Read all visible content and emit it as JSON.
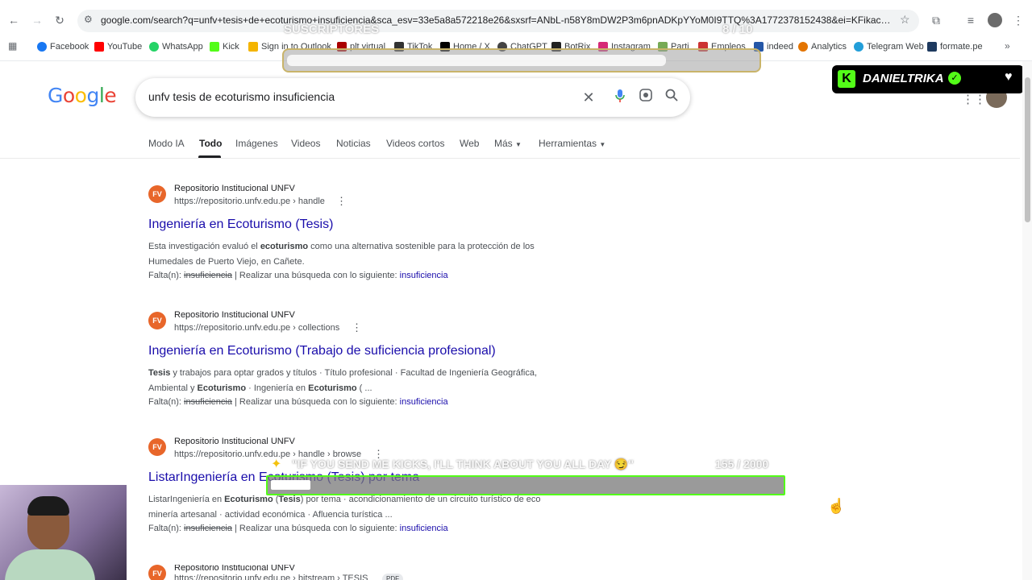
{
  "browser": {
    "url": "google.com/search?q=unfv+tesis+de+ecoturismo+insuficiencia&sca_esv=33e5a8a572218e26&sxsrf=ANbL-n58Y8mDW2P3m6pnADKpYYoM0I9TTQ%3A1772378152438&ei=KFikacW0GqjR1sQPh9r...",
    "bookmarks": [
      "Facebook",
      "YouTube",
      "WhatsApp",
      "Kick",
      "Sign in to Outlook",
      "plt virtual",
      "TikTok",
      "Home / X",
      "ChatGPT",
      "BotRix",
      "Instagram",
      "Parti",
      "Empleos",
      "indeed",
      "Analytics",
      "Telegram Web",
      "formate.pe"
    ]
  },
  "google": {
    "query": "unfv tesis de ecoturismo insuficiencia",
    "tabs": [
      "Modo IA",
      "Todo",
      "Imágenes",
      "Videos",
      "Noticias",
      "Videos cortos",
      "Web",
      "Más",
      "Herramientas"
    ],
    "active_tab": "Todo"
  },
  "results": [
    {
      "favicon": "FV",
      "site": "Repositorio Institucional UNFV",
      "cite": "https://repositorio.unfv.edu.pe › handle",
      "title": "Ingeniería en Ecoturismo (Tesis)",
      "snippet_1a": "Esta investigación evaluó el ",
      "snippet_1b": "ecoturismo",
      "snippet_1c": " como una alternativa sostenible para la protección de los",
      "snippet_2": "Humedales de Puerto Viejo, en Cañete.",
      "missing_label": "Falta(n): ",
      "missing_word": "insuficiencia",
      "missing_action": " | Realizar una búsqueda con lo siguiente: ",
      "missing_link": "insuficiencia"
    },
    {
      "favicon": "FV",
      "site": "Repositorio Institucional UNFV",
      "cite": "https://repositorio.unfv.edu.pe › collections",
      "title": "Ingeniería en Ecoturismo (Trabajo de suficiencia profesional)",
      "snippet_1a": "Tesis",
      "snippet_1b": " y trabajos para optar grados y títulos · Título profesional · Facultad de Ingeniería Geográfica,",
      "snippet_2a": "Ambiental y ",
      "snippet_2b": "Ecoturismo",
      "snippet_2c": " · Ingeniería en ",
      "snippet_2d": "Ecoturismo",
      "snippet_2e": " ( ...",
      "missing_label": "Falta(n): ",
      "missing_word": "insuficiencia",
      "missing_action": " | Realizar una búsqueda con lo siguiente: ",
      "missing_link": "insuficiencia"
    },
    {
      "favicon": "FV",
      "site": "Repositorio Institucional UNFV",
      "cite": "https://repositorio.unfv.edu.pe › handle › browse",
      "title": "ListarIngeniería en Ecoturismo (Tesis) por tema",
      "snippet_1a": "ListarIngeniería en ",
      "snippet_1b": "Ecoturismo",
      "snippet_1c": " (",
      "snippet_1d": "Tesis",
      "snippet_1e": ") por tema · acondicionamiento de un circuito turístico de eco",
      "snippet_2": "minería artesanal · actividad económica · Afluencia turística ...",
      "missing_label": "Falta(n): ",
      "missing_word": "insuficiencia",
      "missing_action": " | Realizar una búsqueda con lo siguiente: ",
      "missing_link": "insuficiencia"
    },
    {
      "favicon": "FV",
      "site": "Repositorio Institucional UNFV",
      "cite": "https://repositorio.unfv.edu.pe › bitstream › TESIS",
      "badge": "PDF"
    }
  ],
  "overlays": {
    "streamer_name": "DANIELTRIKA",
    "sub_goal_label": "SUSCRIPTORES",
    "sub_goal_count": "8 / 10",
    "kick_goal_label": "\"IF YOU SEND ME KICKS, I'LL THINK ABOUT YOU ALL DAY 😏\"",
    "kick_goal_count": "155 / 2000",
    "kick_goal_progress": 0.0775
  },
  "colors": {
    "link": "#1a0dab",
    "kick_green": "#53fc18",
    "favicon": "#e8662a"
  }
}
